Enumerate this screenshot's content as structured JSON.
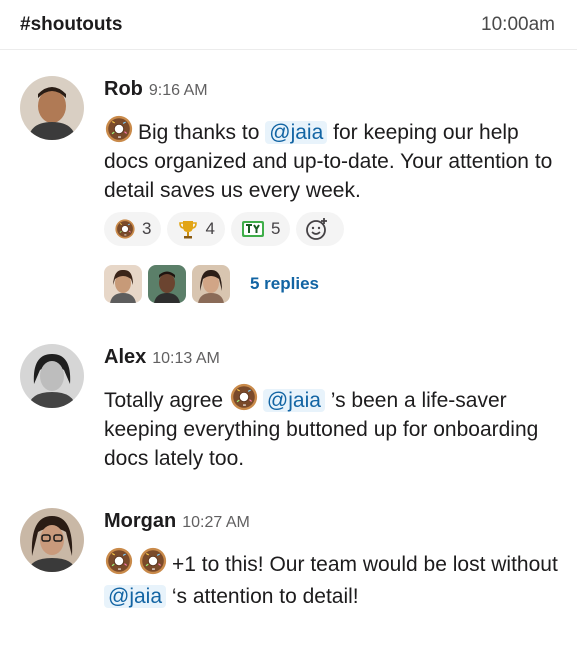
{
  "header": {
    "channel": "#shoutouts",
    "clock": "10:00am"
  },
  "messages": [
    {
      "author": "Rob",
      "time": "9:16 AM",
      "text_parts": [
        "Big thanks to",
        "@jaia",
        "for keeping our help docs organized and up-to-date. Your attention to detail saves us every week."
      ],
      "reactions": [
        {
          "icon": "donut-icon",
          "count": "3"
        },
        {
          "icon": "trophy-icon",
          "count": "4"
        },
        {
          "icon": "ty-icon",
          "count": "5"
        }
      ],
      "replies_label": "5 replies"
    },
    {
      "author": "Alex",
      "time": "10:13 AM",
      "text_parts": [
        "Totally agree",
        "@jaia",
        "’s been a life-saver keeping everything buttoned up for onboarding docs lately too."
      ]
    },
    {
      "author": "Morgan",
      "time": "10:27 AM",
      "text_parts": [
        "+1 to this! Our team would be lost without",
        "@jaia",
        "‘s attention to detail!"
      ]
    }
  ],
  "colors": {
    "mention_bg": "#e8f3fb",
    "mention_text": "#1264a3",
    "link": "#1264a3"
  }
}
